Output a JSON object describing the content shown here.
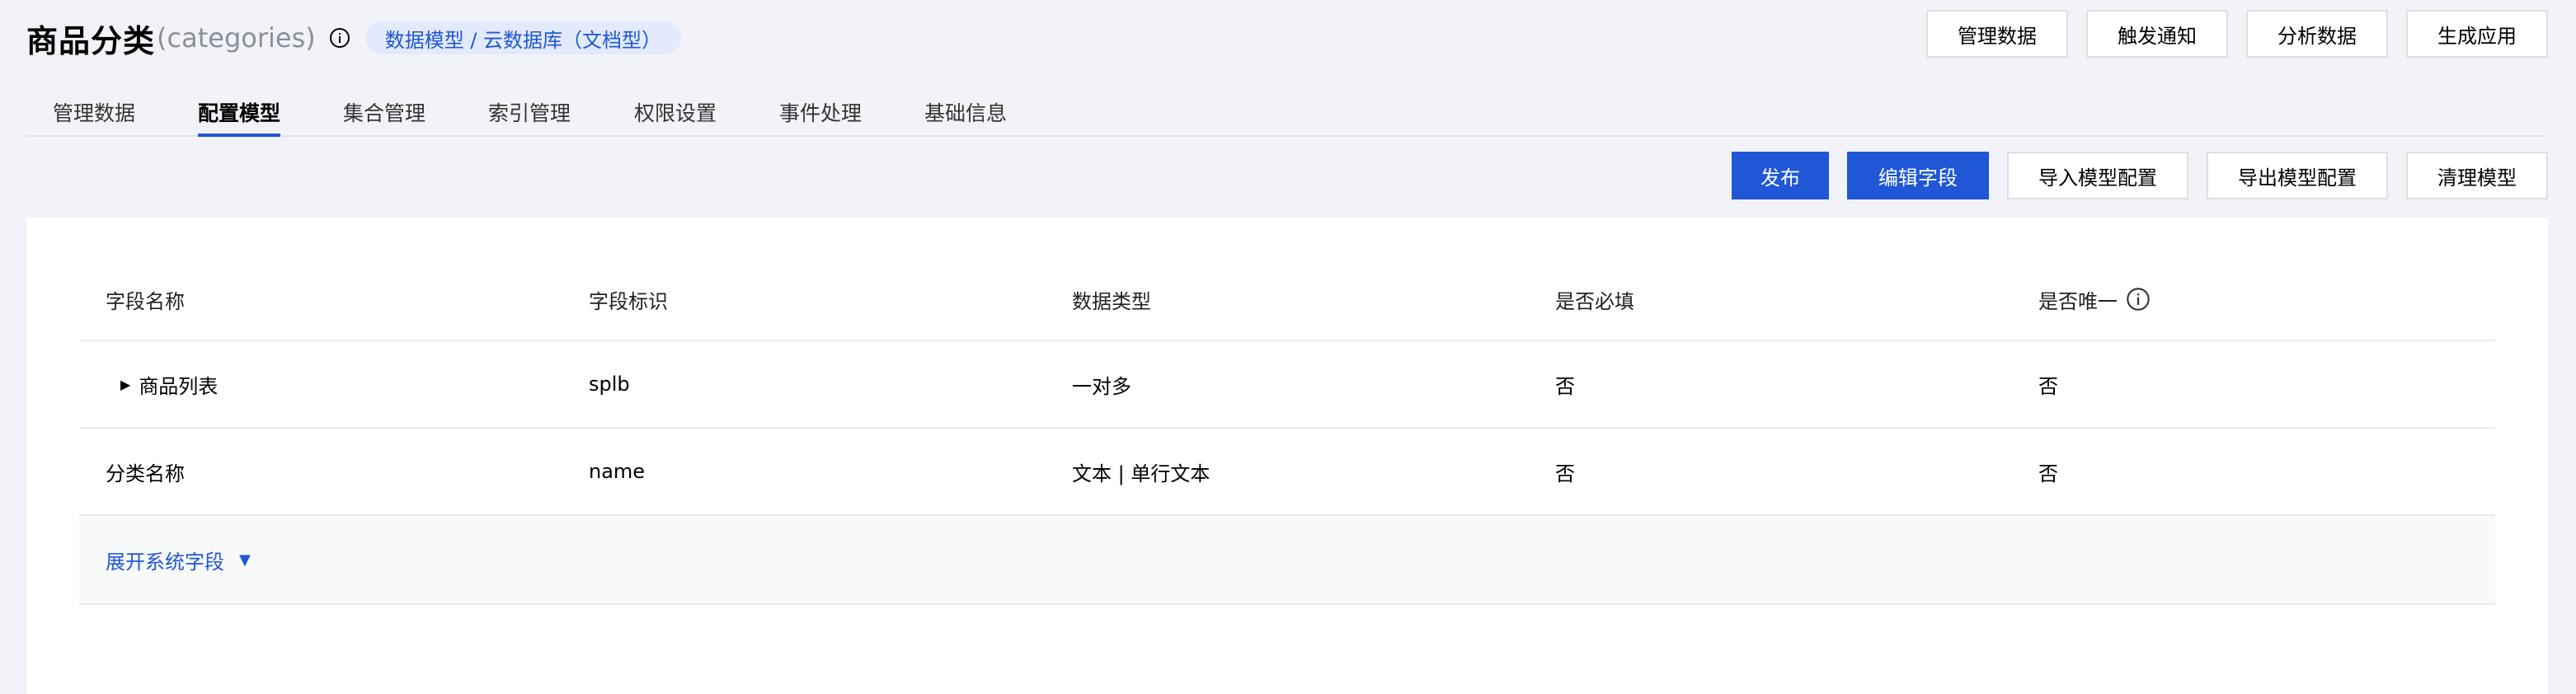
{
  "header": {
    "title": "商品分类",
    "subtitle": "(categories)",
    "badge": "数据模型 / 云数据库（文档型）"
  },
  "top_actions": [
    "管理数据",
    "触发通知",
    "分析数据",
    "生成应用"
  ],
  "tabs": [
    {
      "label": "管理数据",
      "active": false
    },
    {
      "label": "配置模型",
      "active": true
    },
    {
      "label": "集合管理",
      "active": false
    },
    {
      "label": "索引管理",
      "active": false
    },
    {
      "label": "权限设置",
      "active": false
    },
    {
      "label": "事件处理",
      "active": false
    },
    {
      "label": "基础信息",
      "active": false
    }
  ],
  "toolbar": {
    "publish": "发布",
    "edit_fields": "编辑字段",
    "import_config": "导入模型配置",
    "export_config": "导出模型配置",
    "clear_model": "清理模型"
  },
  "table": {
    "columns": [
      "字段名称",
      "字段标识",
      "数据类型",
      "是否必填",
      "是否唯一"
    ],
    "rows": [
      {
        "name": "商品列表",
        "key": "splb",
        "type": "一对多",
        "required": "否",
        "unique": "否",
        "expandable": true
      },
      {
        "name": "分类名称",
        "key": "name",
        "type": "文本 | 单行文本",
        "required": "否",
        "unique": "否",
        "expandable": false
      }
    ],
    "expand_label": "展开系统字段"
  },
  "colors": {
    "accent": "#1f57d6",
    "background": "#f2f3f8",
    "badge_bg": "#e3eafc"
  },
  "icons": {
    "info": "info-circle-icon",
    "row_expand": "triangle-right-icon",
    "expand_caret": "triangle-down-icon"
  }
}
